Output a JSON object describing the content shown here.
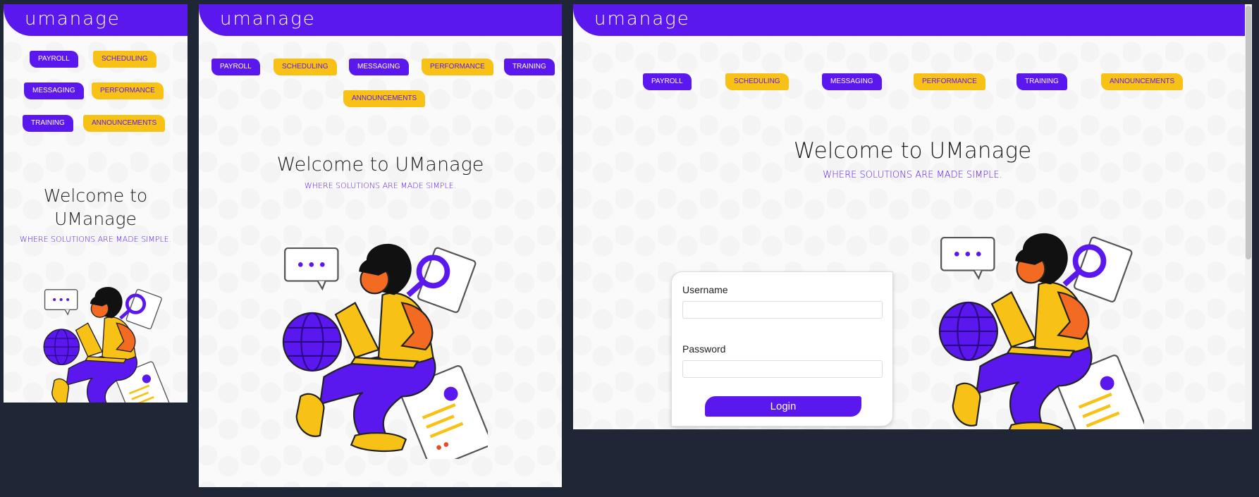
{
  "app": {
    "logo": "umanage"
  },
  "nav": {
    "payroll": "PAYROLL",
    "scheduling": "SCHEDULING",
    "messaging": "MESSAGING",
    "performance": "PERFORMANCE",
    "training": "TRAINING",
    "announcements": "ANNOUNCEMENTS"
  },
  "hero": {
    "title": "Welcome to UManage",
    "title_line1": "Welcome to",
    "title_line2": "UManage",
    "tagline": "WHERE SOLUTIONS ARE MADE SIMPLE."
  },
  "login": {
    "username_label": "Username",
    "username_value": "",
    "password_label": "Password",
    "password_value": "",
    "button_label": "Login"
  },
  "colors": {
    "primary": "#5b18ee",
    "accent": "#f7c215",
    "backdrop": "#1f2737"
  }
}
